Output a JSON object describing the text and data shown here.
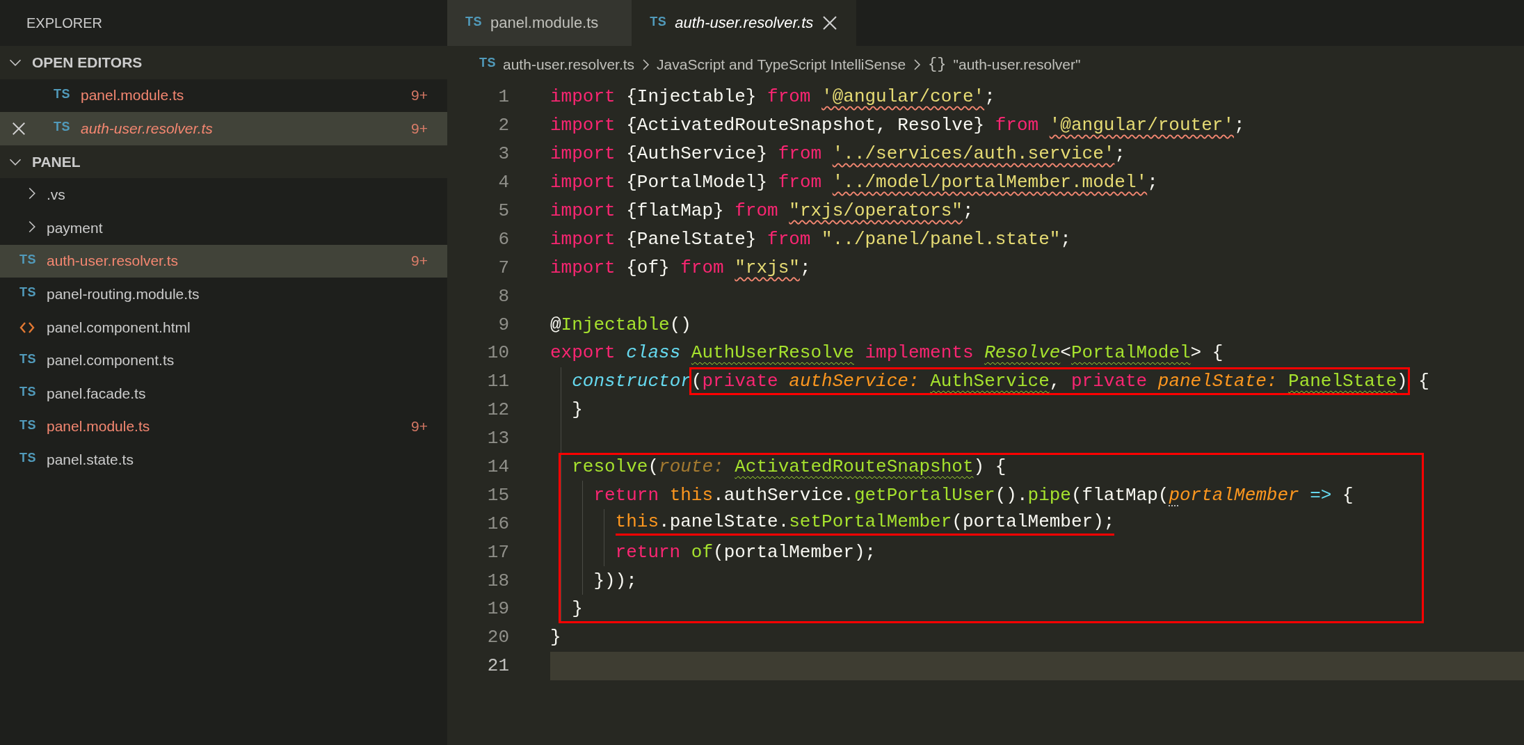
{
  "explorer": {
    "title": "EXPLORER",
    "sections": [
      {
        "title": "OPEN EDITORS",
        "expanded": true,
        "kind": "editors",
        "items": [
          {
            "kind": "ts",
            "icon_text": "TS",
            "label": "panel.module.ts",
            "problems": "9+",
            "preview": false,
            "selected": false,
            "closable": false
          },
          {
            "kind": "ts",
            "icon_text": "TS",
            "label": "auth-user.resolver.ts",
            "problems": "9+",
            "preview": true,
            "selected": true,
            "closable": true
          }
        ]
      },
      {
        "title": "PANEL",
        "expanded": true,
        "kind": "folder",
        "items": [
          {
            "kind": "folder",
            "label": ".vs",
            "expanded": false,
            "selected": false
          },
          {
            "kind": "folder",
            "label": "payment",
            "expanded": false,
            "selected": false
          },
          {
            "kind": "ts",
            "icon_text": "TS",
            "label": "auth-user.resolver.ts",
            "problems": "9+",
            "selected": true
          },
          {
            "kind": "ts",
            "icon_text": "TS",
            "label": "panel-routing.module.ts",
            "selected": false
          },
          {
            "kind": "html",
            "label": "panel.component.html",
            "selected": false
          },
          {
            "kind": "ts",
            "icon_text": "TS",
            "label": "panel.component.ts",
            "selected": false
          },
          {
            "kind": "ts",
            "icon_text": "TS",
            "label": "panel.facade.ts",
            "selected": false
          },
          {
            "kind": "ts",
            "icon_text": "TS",
            "label": "panel.module.ts",
            "problems": "9+",
            "selected": false
          },
          {
            "kind": "ts",
            "icon_text": "TS",
            "label": "panel.state.ts",
            "selected": false
          }
        ]
      }
    ]
  },
  "tabs": [
    {
      "icon_text": "TS",
      "label": "panel.module.ts",
      "selected": false,
      "preview": false
    },
    {
      "icon_text": "TS",
      "label": "auth-user.resolver.ts",
      "selected": true,
      "preview": true
    }
  ],
  "breadcrumb": {
    "icon_text": "TS",
    "items": [
      "auth-user.resolver.ts",
      "JavaScript and TypeScript IntelliSense"
    ],
    "symbol_icon": "{}",
    "symbol": "\"auth-user.resolver\""
  },
  "code": {
    "lines": [
      {
        "number": "1",
        "current": false,
        "boxed": false,
        "tokens": [
          {
            "text": "import",
            "kind": "keyword"
          },
          {
            "text": " {Injectable} ",
            "kind": "plain"
          },
          {
            "text": "from ",
            "kind": "keyword"
          },
          {
            "text": "'@angular/core'",
            "kind": "string_error"
          },
          {
            "text": ";",
            "kind": "plain"
          }
        ]
      },
      {
        "number": "2",
        "current": false,
        "boxed": false,
        "tokens": [
          {
            "text": "import",
            "kind": "keyword"
          },
          {
            "text": " {ActivatedRouteSnapshot, Resolve} ",
            "kind": "plain"
          },
          {
            "text": "from ",
            "kind": "keyword"
          },
          {
            "text": "'@angular/router'",
            "kind": "string_error"
          },
          {
            "text": ";",
            "kind": "plain"
          }
        ]
      },
      {
        "number": "3",
        "current": false,
        "boxed": false,
        "tokens": [
          {
            "text": "import",
            "kind": "keyword"
          },
          {
            "text": " {AuthService} ",
            "kind": "plain"
          },
          {
            "text": "from ",
            "kind": "keyword"
          },
          {
            "text": "'../services/auth.service'",
            "kind": "string_error"
          },
          {
            "text": ";",
            "kind": "plain"
          }
        ]
      },
      {
        "number": "4",
        "current": false,
        "boxed": false,
        "tokens": [
          {
            "text": "import",
            "kind": "keyword"
          },
          {
            "text": " {PortalModel} ",
            "kind": "plain"
          },
          {
            "text": "from ",
            "kind": "keyword"
          },
          {
            "text": "'../model/portalMember.model'",
            "kind": "string_error"
          },
          {
            "text": ";",
            "kind": "plain"
          }
        ]
      },
      {
        "number": "5",
        "current": false,
        "boxed": false,
        "tokens": [
          {
            "text": "import",
            "kind": "keyword"
          },
          {
            "text": " {flatMap} ",
            "kind": "plain"
          },
          {
            "text": "from ",
            "kind": "keyword"
          },
          {
            "text": "\"rxjs/operators\"",
            "kind": "string_error"
          },
          {
            "text": ";",
            "kind": "plain"
          }
        ]
      },
      {
        "number": "6",
        "current": false,
        "boxed": false,
        "tokens": [
          {
            "text": "import",
            "kind": "keyword"
          },
          {
            "text": " {PanelState} ",
            "kind": "plain"
          },
          {
            "text": "from ",
            "kind": "keyword"
          },
          {
            "text": "\"../panel/panel.state\"",
            "kind": "string"
          },
          {
            "text": ";",
            "kind": "plain"
          }
        ]
      },
      {
        "number": "7",
        "current": false,
        "boxed": false,
        "tokens": [
          {
            "text": "import",
            "kind": "keyword"
          },
          {
            "text": " {of} ",
            "kind": "plain"
          },
          {
            "text": "from ",
            "kind": "keyword"
          },
          {
            "text": "\"rxjs\"",
            "kind": "string_error"
          },
          {
            "text": ";",
            "kind": "plain"
          }
        ]
      },
      {
        "number": "8",
        "current": false,
        "boxed": false
      },
      {
        "number": "9",
        "current": false,
        "boxed": false,
        "tokens": [
          {
            "text": "@",
            "kind": "plain"
          },
          {
            "text": "Injectable",
            "kind": "func"
          },
          {
            "text": "()",
            "kind": "plain"
          }
        ]
      },
      {
        "number": "10",
        "current": false,
        "boxed": false,
        "tokens": [
          {
            "text": "export ",
            "kind": "keyword"
          },
          {
            "text": "class ",
            "kind": "storage"
          },
          {
            "text": "AuthUserResolve",
            "kind": "type_hint"
          },
          {
            "text": " implements ",
            "kind": "keyword"
          },
          {
            "text": "Resolve",
            "kind": "inherited_hint"
          },
          {
            "text": "<",
            "kind": "plain"
          },
          {
            "text": "PortalModel",
            "kind": "type_hint"
          },
          {
            "text": "> {",
            "kind": "plain"
          }
        ],
        "children": [
          {
            "number": "11",
            "current": false,
            "boxed": false,
            "tokens": [
              {
                "text": "constructor",
                "kind": "storage"
              },
              {
                "kind": "box",
                "tokens": [
                  {
                    "text": "(",
                    "kind": "plain"
                  },
                  {
                    "text": "private ",
                    "kind": "keyword"
                  },
                  {
                    "text": "authService: ",
                    "kind": "param"
                  },
                  {
                    "text": "AuthService",
                    "kind": "type_hint"
                  },
                  {
                    "text": ", ",
                    "kind": "plain"
                  },
                  {
                    "text": "private ",
                    "kind": "keyword"
                  },
                  {
                    "text": "panelState: ",
                    "kind": "param"
                  },
                  {
                    "text": "PanelState",
                    "kind": "type_hint"
                  },
                  {
                    "text": ")",
                    "kind": "plain"
                  }
                ]
              },
              {
                "text": " {",
                "kind": "plain"
              }
            ]
          },
          {
            "number": "12",
            "current": false,
            "boxed": false,
            "tokens": [
              {
                "text": "}",
                "kind": "plain"
              }
            ]
          },
          {
            "number": "13",
            "current": false,
            "boxed": false
          },
          {
            "number": "14",
            "current": false,
            "boxed": true,
            "tokens": [
              {
                "text": "resolve",
                "kind": "func"
              },
              {
                "text": "(",
                "kind": "plain"
              },
              {
                "text": "route: ",
                "kind": "unused"
              },
              {
                "text": "ActivatedRouteSnapshot",
                "kind": "type_hint"
              },
              {
                "text": ") {",
                "kind": "plain"
              }
            ],
            "children": [
              {
                "number": "15",
                "current": false,
                "boxed": true,
                "tokens": [
                  {
                    "text": "return ",
                    "kind": "keyword"
                  },
                  {
                    "text": "this",
                    "kind": "this"
                  },
                  {
                    "text": ".authService.",
                    "kind": "plain"
                  },
                  {
                    "text": "getPortalUser",
                    "kind": "func"
                  },
                  {
                    "text": "().",
                    "kind": "plain"
                  },
                  {
                    "text": "pipe",
                    "kind": "func"
                  },
                  {
                    "text": "(flatMap(",
                    "kind": "plain"
                  },
                  {
                    "text": "p",
                    "kind": "param_dots"
                  },
                  {
                    "text": "ortalMember ",
                    "kind": "param"
                  },
                  {
                    "text": "=>",
                    "kind": "operator"
                  },
                  {
                    "text": " {",
                    "kind": "plain"
                  }
                ],
                "children": [
                  {
                    "number": "16",
                    "current": false,
                    "boxed": true,
                    "tokens": [
                      {
                        "kind": "underline",
                        "tokens": [
                          {
                            "text": "this",
                            "kind": "this"
                          },
                          {
                            "text": ".panelState.",
                            "kind": "plain"
                          },
                          {
                            "text": "setPortalMember",
                            "kind": "func"
                          },
                          {
                            "text": "(portalMember);",
                            "kind": "plain"
                          }
                        ]
                      }
                    ]
                  },
                  {
                    "number": "17",
                    "current": false,
                    "boxed": true,
                    "tokens": [
                      {
                        "text": "return ",
                        "kind": "keyword"
                      },
                      {
                        "text": "of",
                        "kind": "func"
                      },
                      {
                        "text": "(portalMember);",
                        "kind": "plain"
                      }
                    ]
                  }
                ]
              },
              {
                "number": "18",
                "current": false,
                "boxed": true,
                "tokens": [
                  {
                    "text": "}));",
                    "kind": "plain"
                  }
                ]
              }
            ]
          },
          {
            "number": "19",
            "current": false,
            "boxed": true,
            "tokens": [
              {
                "text": "}",
                "kind": "plain"
              }
            ]
          }
        ]
      },
      {
        "number": "20",
        "current": false,
        "boxed": false,
        "tokens": [
          {
            "text": "}",
            "kind": "plain"
          }
        ]
      },
      {
        "number": "21",
        "current": true,
        "boxed": false
      }
    ]
  }
}
